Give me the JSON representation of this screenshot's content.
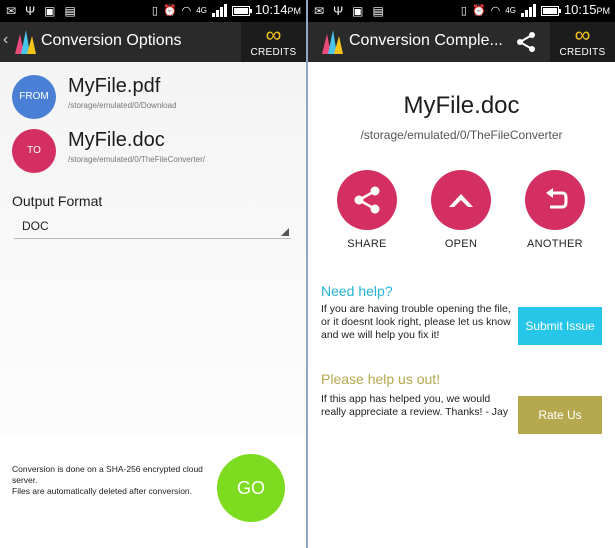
{
  "left": {
    "status": {
      "icons_left": [
        "email-icon",
        "usb-icon",
        "debug-icon",
        "notes-icon"
      ],
      "network": "4G",
      "time": "10:14",
      "ampm": "PM"
    },
    "actionbar": {
      "title": "Conversion Options",
      "credits_symbol": "∞",
      "credits_label": "CREDITS"
    },
    "from": {
      "badge": "FROM",
      "filename": "MyFile.pdf",
      "path": "/storage/emulated/0/Download"
    },
    "to": {
      "badge": "TO",
      "filename": "MyFile.doc",
      "path": "/storage/emulated/0/TheFileConverter/"
    },
    "output_format": {
      "label": "Output Format",
      "selected": "DOC"
    },
    "footer": {
      "line1": "Conversion is done on a SHA-256 encrypted cloud server.",
      "line2": "Files are automatically deleted after conversion.",
      "go_label": "GO"
    }
  },
  "right": {
    "status": {
      "network": "4G",
      "time": "10:15",
      "ampm": "PM"
    },
    "actionbar": {
      "title": "Conversion Comple...",
      "credits_symbol": "∞",
      "credits_label": "CREDITS"
    },
    "result": {
      "filename": "MyFile.doc",
      "path": "/storage/emulated/0/TheFileConverter"
    },
    "actions": {
      "share": "SHARE",
      "open": "OPEN",
      "another": "ANOTHER"
    },
    "help": {
      "title": "Need help?",
      "body": "If you are having trouble opening the file, or it doesnt look right, please let us know and we will help you fix it!",
      "button": "Submit Issue"
    },
    "review": {
      "title": "Please help us out!",
      "body": "If this app has helped you, we would really appreciate a review. Thanks! - Jay",
      "button": "Rate Us"
    }
  },
  "colors": {
    "from_badge": "#4a7fd6",
    "to_badge": "#d42f62",
    "action_disc": "#d42f62",
    "go_button": "#7ddc1f",
    "help_title": "#26b3d6",
    "submit_button": "#26c6e8",
    "review_title": "#b5a84e",
    "rate_button": "#b5a84e",
    "credits_symbol": "#f5c319"
  }
}
